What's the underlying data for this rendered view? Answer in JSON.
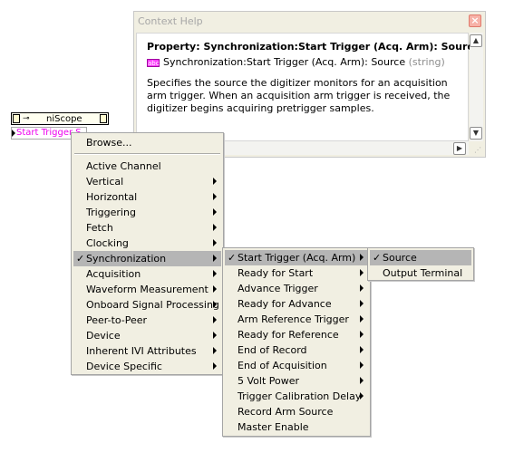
{
  "help": {
    "title": "Context Help",
    "close_glyph": "×",
    "property_line": "Property:  Synchronization:Start Trigger (Acq. Arm): Source",
    "type_icon_text": "abc",
    "type_name": "Synchronization:Start Trigger (Acq. Arm): Source",
    "type_kind": "(string)",
    "description": "Specifies the source the digitizer monitors for an acquisition arm trigger. When an acquisition arm trigger is received, the digitizer begins acquiring pretrigger samples."
  },
  "node": {
    "title": "niScope",
    "property_label": "Start Trigger S",
    "terminal_left": "⬚",
    "terminal_right": "⬚"
  },
  "menu1": {
    "items": [
      {
        "label": "Browse...",
        "has_submenu": false
      },
      {
        "label": "Active Channel",
        "has_submenu": false
      },
      {
        "label": "Vertical",
        "has_submenu": true
      },
      {
        "label": "Horizontal",
        "has_submenu": true
      },
      {
        "label": "Triggering",
        "has_submenu": true
      },
      {
        "label": "Fetch",
        "has_submenu": true
      },
      {
        "label": "Clocking",
        "has_submenu": true
      },
      {
        "label": "Synchronization",
        "has_submenu": true,
        "checked": true,
        "selected": true
      },
      {
        "label": "Acquisition",
        "has_submenu": true
      },
      {
        "label": "Waveform Measurement",
        "has_submenu": true
      },
      {
        "label": "Onboard Signal Processing",
        "has_submenu": true
      },
      {
        "label": "Peer-to-Peer",
        "has_submenu": true
      },
      {
        "label": "Device",
        "has_submenu": true
      },
      {
        "label": "Inherent IVI Attributes",
        "has_submenu": true
      },
      {
        "label": "Device Specific",
        "has_submenu": true
      }
    ]
  },
  "menu2": {
    "items": [
      {
        "label": "Start Trigger (Acq. Arm)",
        "has_submenu": true,
        "checked": true,
        "selected": true
      },
      {
        "label": "Ready for Start",
        "has_submenu": true
      },
      {
        "label": "Advance Trigger",
        "has_submenu": true
      },
      {
        "label": "Ready for Advance",
        "has_submenu": true
      },
      {
        "label": "Arm Reference Trigger",
        "has_submenu": true
      },
      {
        "label": "Ready for Reference",
        "has_submenu": true
      },
      {
        "label": "End of Record",
        "has_submenu": true
      },
      {
        "label": "End of Acquisition",
        "has_submenu": true
      },
      {
        "label": "5 Volt Power",
        "has_submenu": true
      },
      {
        "label": "Trigger Calibration Delay",
        "has_submenu": true
      },
      {
        "label": "Record Arm Source",
        "has_submenu": false
      },
      {
        "label": "Master Enable",
        "has_submenu": false
      }
    ]
  },
  "menu3": {
    "items": [
      {
        "label": "Source",
        "checked": true,
        "selected": true
      },
      {
        "label": "Output Terminal"
      }
    ]
  },
  "check_glyph": "✓"
}
